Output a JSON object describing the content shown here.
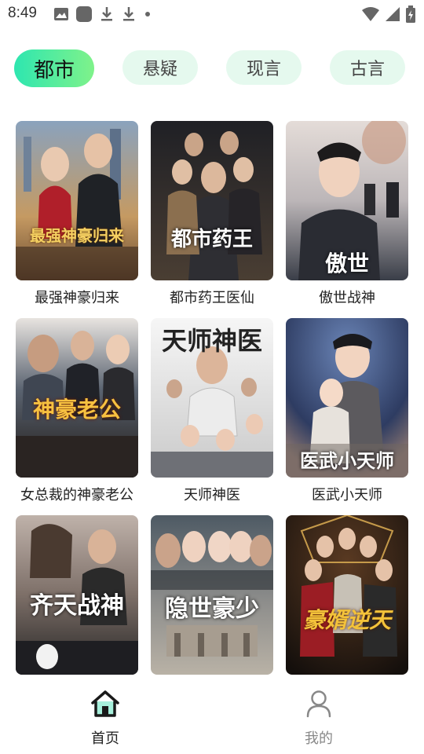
{
  "status_bar": {
    "time": "8:49",
    "left_icons": [
      "image-icon",
      "app-icon",
      "download-icon",
      "download-icon",
      "dot-icon"
    ],
    "right_icons": [
      "wifi-icon",
      "signal-icon",
      "battery-icon"
    ]
  },
  "tabs": [
    {
      "label": "都市",
      "active": true
    },
    {
      "label": "悬疑",
      "active": false
    },
    {
      "label": "现言",
      "active": false
    },
    {
      "label": "古言",
      "active": false
    }
  ],
  "dramas": [
    {
      "title": "最强神豪归来",
      "poster_text": "最强神豪归来",
      "colors": [
        "#7a8fa8",
        "#c8a26a"
      ]
    },
    {
      "title": "都市药王医仙",
      "poster_text": "都市药王",
      "colors": [
        "#2a2a30",
        "#6b5a48"
      ]
    },
    {
      "title": "傲世战神",
      "poster_text": "傲世",
      "colors": [
        "#d9cfcc",
        "#3a3f4c"
      ]
    },
    {
      "title": "女总裁的神豪老公",
      "poster_text": "神豪老公",
      "colors": [
        "#5c6470",
        "#2a1f1a"
      ]
    },
    {
      "title": "天师神医",
      "poster_text": "天师神医",
      "colors": [
        "#f2f2f2",
        "#7c7f84"
      ]
    },
    {
      "title": "医武小天师",
      "poster_text": "医武小天师",
      "colors": [
        "#3b4f78",
        "#b9a6a8"
      ]
    },
    {
      "title": "",
      "poster_text": "齐天战神",
      "colors": [
        "#8a7a72",
        "#2a2a2a"
      ]
    },
    {
      "title": "",
      "poster_text": "隐世豪少",
      "colors": [
        "#52606a",
        "#b7b0a6"
      ]
    },
    {
      "title": "",
      "poster_text": "豪婿逆天",
      "colors": [
        "#1a1410",
        "#6a4a2a"
      ]
    }
  ],
  "bottom_nav": {
    "home_label": "首页",
    "mine_label": "我的",
    "active_color": "#1d9b8a"
  }
}
